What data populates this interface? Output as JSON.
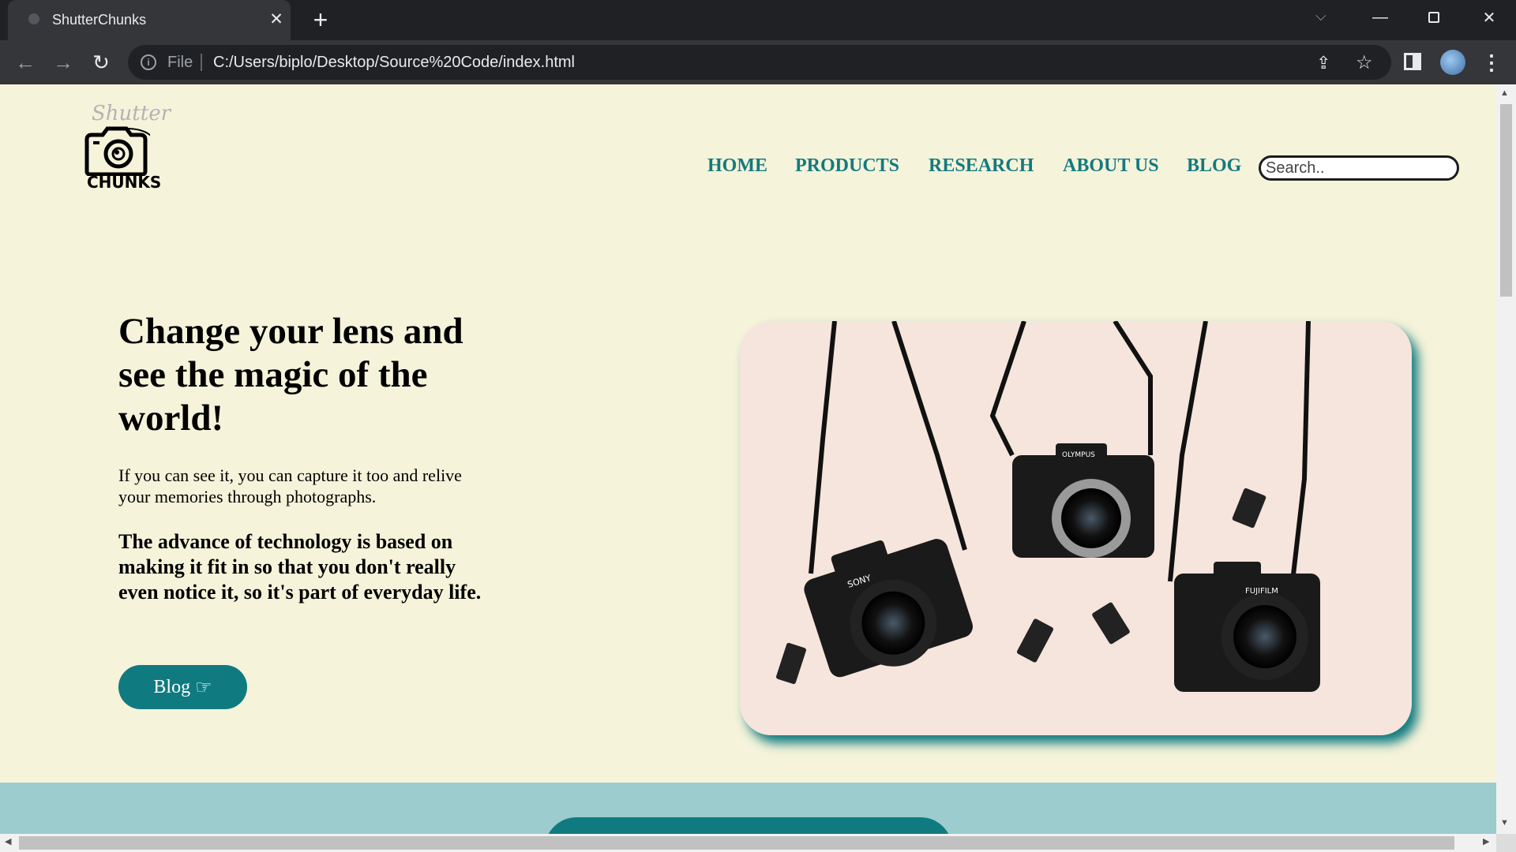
{
  "browser": {
    "tab_title": "ShutterChunks",
    "tab_close": "✕",
    "new_tab": "+",
    "file_label": "File",
    "url": "C:/Users/biplo/Desktop/Source%20Code/index.html",
    "icons": [
      "back-arrow-icon",
      "forward-arrow-icon",
      "reload-icon",
      "info-icon",
      "share-icon",
      "star-icon",
      "side-panel-icon",
      "profile-avatar",
      "menu-icon"
    ]
  },
  "logo": {
    "script_text": "Shutter",
    "word_text": "CHUNKS"
  },
  "nav": {
    "home": "HOME",
    "products": "PRODUCTS",
    "research": "RESEARCH",
    "about": "ABOUT US",
    "blog": "BLOG",
    "search_placeholder": "Search.."
  },
  "hero": {
    "title": "Change your lens and see the magic of the world!",
    "text": "If you can see it, you can capture it too and relive your memories through photographs.",
    "quote": "The advance of technology is based on making it fit in so that you don't really even notice it, so it's part of everyday life.",
    "button_label": "Blog",
    "button_icon": "☞",
    "camera_brands": [
      "SONY",
      "OLYMPUS",
      "FUJIFILM"
    ]
  },
  "colors": {
    "page_bg": "#f5f3da",
    "accent": "#0f7b80",
    "band": "#9ccccd"
  }
}
